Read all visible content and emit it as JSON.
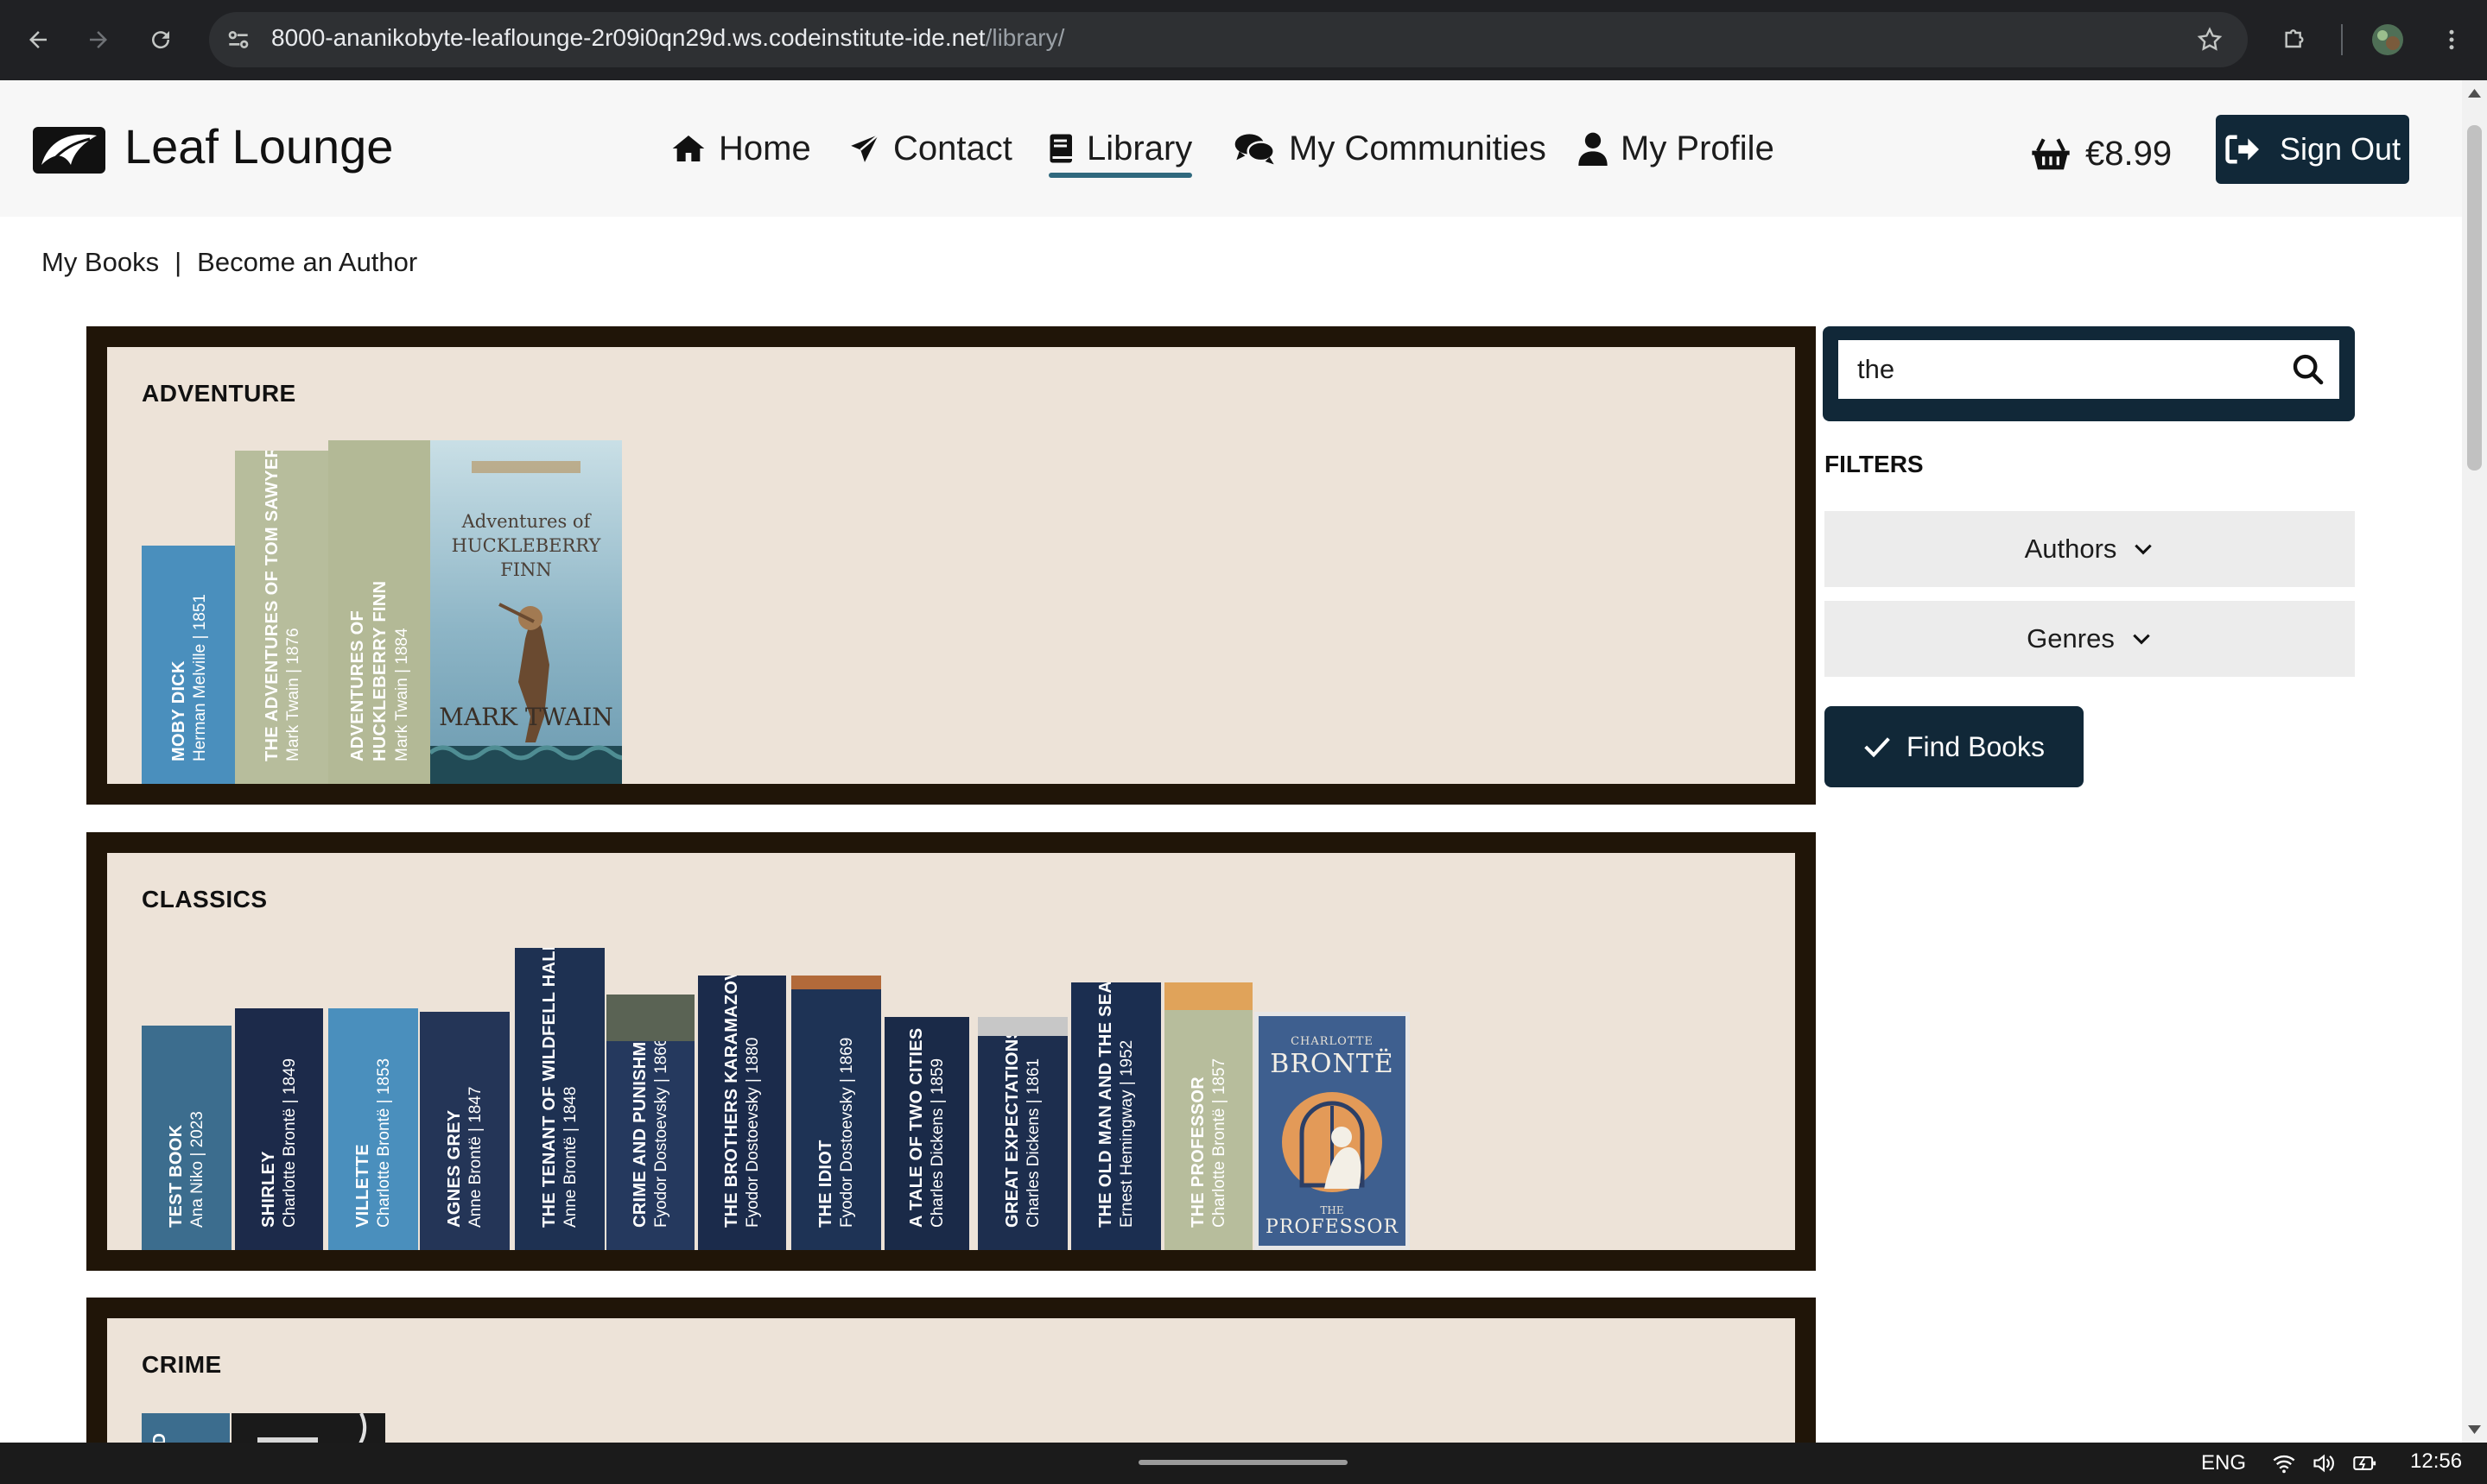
{
  "browser": {
    "url_host": "8000-ananikobyte-leaflounge-2r09i0qn29d.ws.codeinstitute-ide.net",
    "url_path": "/library/"
  },
  "header": {
    "brand": "Leaf Lounge",
    "menu": [
      {
        "label": "Home",
        "icon": "home-icon"
      },
      {
        "label": "Contact",
        "icon": "paper-plane-icon"
      },
      {
        "label": "Library",
        "icon": "book-icon",
        "active": true
      },
      {
        "label": "My Communities",
        "icon": "comments-icon"
      },
      {
        "label": "My Profile",
        "icon": "user-icon"
      }
    ],
    "basket_total": "€8.99",
    "sign_out_label": "Sign Out"
  },
  "subnav": {
    "my_books": "My Books",
    "separator": "|",
    "become_author": "Become an Author"
  },
  "shelves": [
    {
      "title": "ADVENTURE",
      "books": [
        {
          "title": "MOBY DICK",
          "meta": "Herman Melville | 1851",
          "color": "#4a8fbd",
          "text_color": "#ffffff"
        },
        {
          "title": "THE ADVENTURES OF TOM SAWYER",
          "meta": "Mark Twain | 1876",
          "color": "#b7bd9c",
          "text_color": "#ffffff"
        },
        {
          "title": "ADVENTURES OF HUCKLEBERRY FINN",
          "meta": "Mark Twain | 1884",
          "color": "#b3b996",
          "text_color": "#ffffff"
        },
        {
          "cover_title": "Adventures of HUCKLEBERRY FINN",
          "cover_author": "MARK TWAIN",
          "color": "#9fc3d1"
        }
      ]
    },
    {
      "title": "CLASSICS",
      "books": [
        {
          "title": "TEST BOOK",
          "meta": "Ana Niko | 2023",
          "color": "#3c6d8e",
          "text_color": "#ffffff"
        },
        {
          "title": "SHIRLEY",
          "meta": "Charlotte Brontë | 1849",
          "color": "#1c2a4a",
          "text_color": "#ffffff"
        },
        {
          "title": "VILLETTE",
          "meta": "Charlotte Brontë | 1853",
          "color": "#4a8fbd",
          "text_color": "#ffffff"
        },
        {
          "title": "AGNES GREY",
          "meta": "Anne Brontë | 1847",
          "color": "#243557",
          "text_color": "#ffffff"
        },
        {
          "title": "THE TENANT OF WILDFELL HALL",
          "meta": "Anne Brontë | 1848",
          "color": "#1e3152",
          "text_color": "#ffffff"
        },
        {
          "title": "CRIME AND PUNISHMENT",
          "meta": "Fyodor Dostoevsky | 1866",
          "color": "#25395e",
          "text_color": "#ffffff"
        },
        {
          "title": "THE BROTHERS KARAMAZOV",
          "meta": "Fyodor Dostoevsky | 1880",
          "color": "#1b2b4b",
          "text_color": "#ffffff"
        },
        {
          "title": "THE IDIOT",
          "meta": "Fyodor Dostoevsky | 1869",
          "color": "#1e3355",
          "text_color": "#ffffff"
        },
        {
          "title": "A TALE OF TWO CITIES",
          "meta": "Charles Dickens | 1859",
          "color": "#1a2a48",
          "text_color": "#ffffff"
        },
        {
          "title": "GREAT EXPECTATIONS",
          "meta": "Charles Dickens | 1861",
          "color": "#1d2e4e",
          "text_color": "#ffffff"
        },
        {
          "title": "THE OLD MAN AND THE SEA",
          "meta": "Ernest Hemingway | 1952",
          "color": "#1b2e50",
          "text_color": "#ffffff"
        },
        {
          "title": "THE PROFESSOR",
          "meta": "Charlotte Brontë | 1857",
          "color": "#b7bd9c",
          "text_color": "#ffffff"
        },
        {
          "cover_top": "CHARLOTTE",
          "cover_title": "BRONTË",
          "cover_the": "THE",
          "cover_sub": "PROFESSOR",
          "color": "#3e5f8f"
        }
      ]
    },
    {
      "title": "CRIME",
      "books": [
        {
          "title": "RD",
          "meta": "",
          "color": "#3c6d8e",
          "text_color": "#ffffff"
        }
      ]
    }
  ],
  "sidebar": {
    "search_value": "the",
    "filters_label": "FILTERS",
    "authors_label": "Authors",
    "genres_label": "Genres",
    "find_books_label": "Find Books"
  },
  "taskbar": {
    "lang": "ENG",
    "time": "12:56"
  },
  "colors": {
    "navy": "#112838",
    "shelf_frame": "#201508",
    "shelf_bg": "#ede3d8",
    "accent_underline": "#30697e"
  }
}
